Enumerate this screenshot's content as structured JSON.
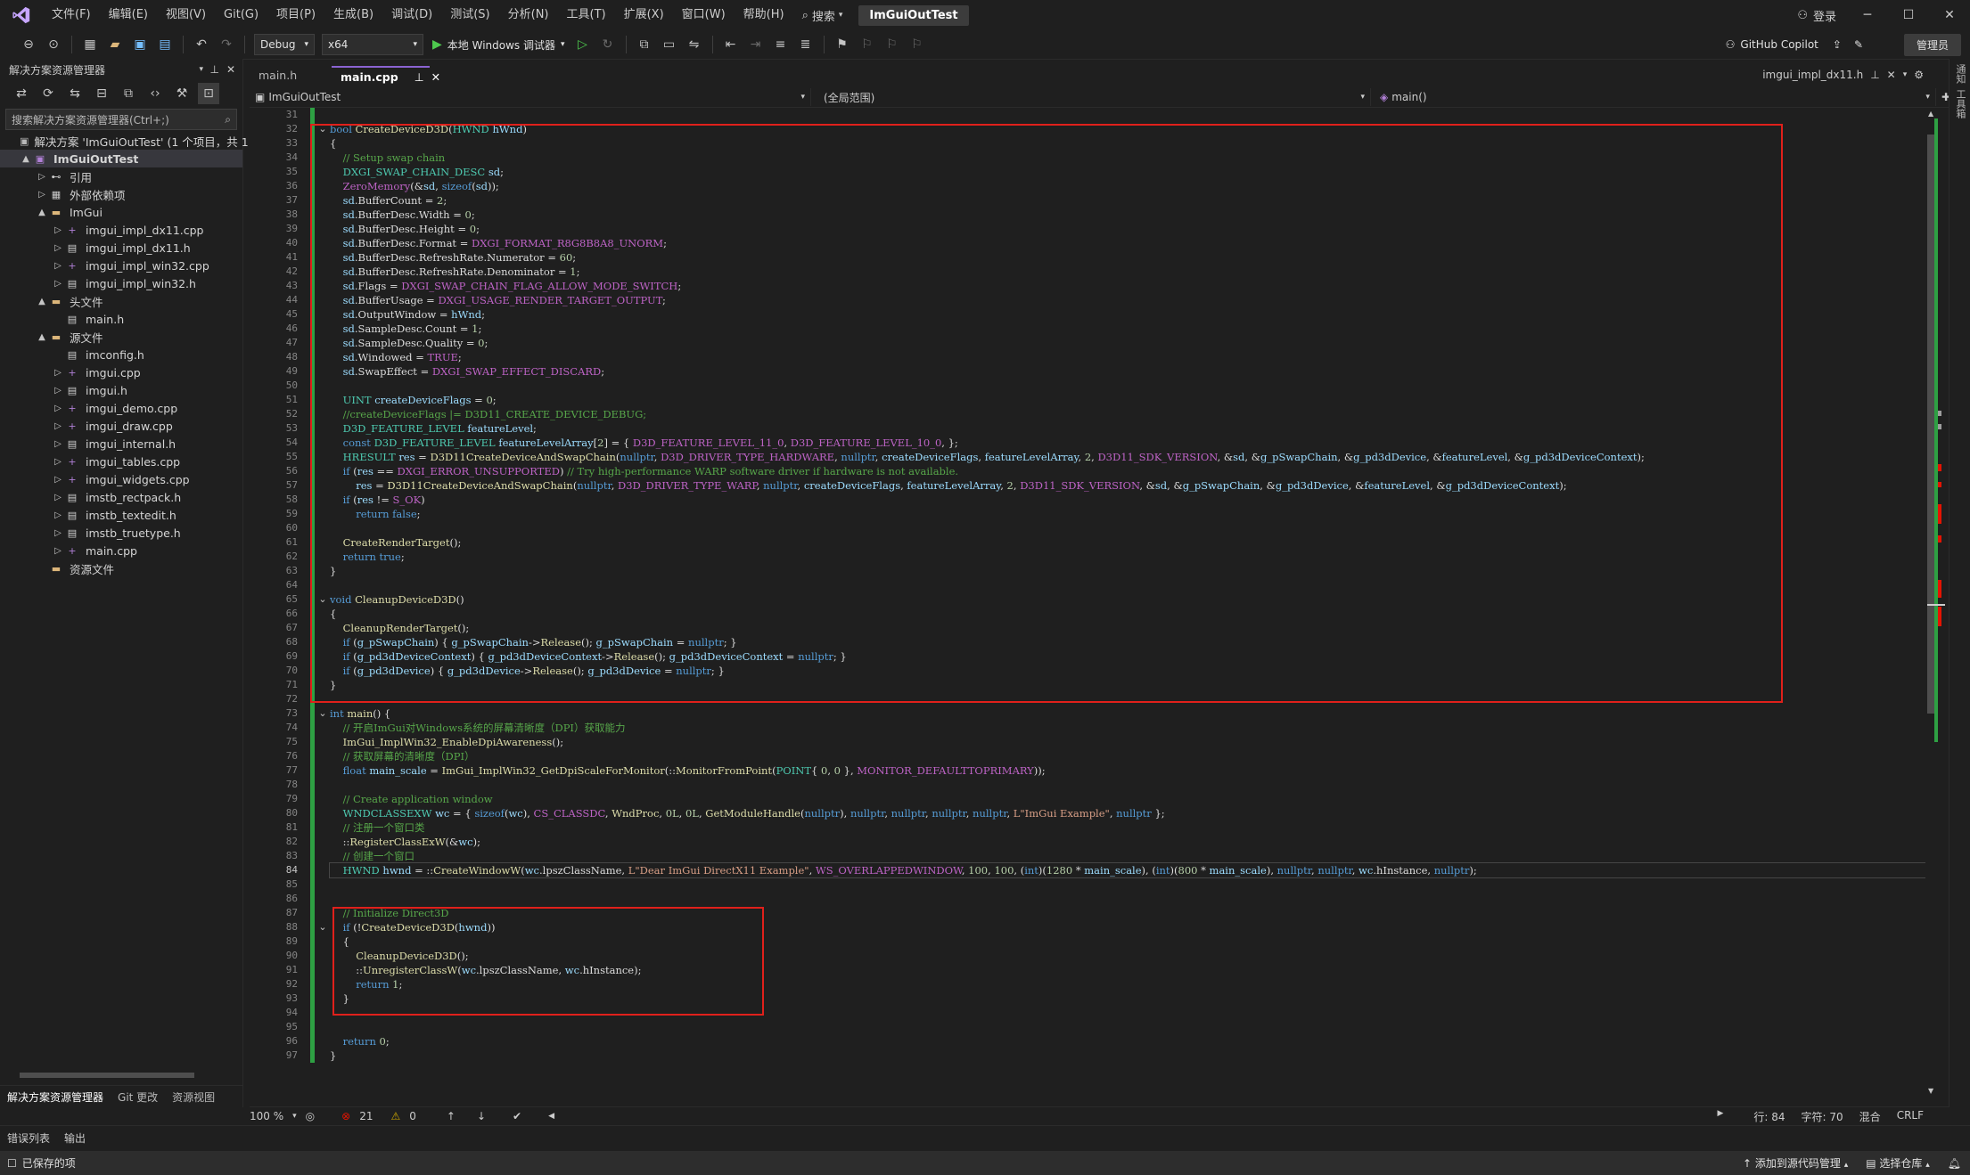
{
  "title_bar": {
    "menu": [
      "文件(F)",
      "编辑(E)",
      "视图(V)",
      "Git(G)",
      "项目(P)",
      "生成(B)",
      "调试(D)",
      "测试(S)",
      "分析(N)",
      "工具(T)",
      "扩展(X)",
      "窗口(W)",
      "帮助(H)"
    ],
    "search_label": "搜索",
    "solution_name": "ImGuiOutTest",
    "login_label": "登录"
  },
  "toolbar": {
    "config": "Debug",
    "platform": "x64",
    "run_label": "本地 Windows 调试器",
    "copilot_label": "GitHub Copilot",
    "admin_label": "管理员"
  },
  "solution_explorer": {
    "title": "解决方案资源管理器",
    "search_placeholder": "搜索解决方案资源管理器(Ctrl+;)",
    "tree": [
      {
        "label": "解决方案 'ImGuiOutTest' (1 个项目，共 1",
        "depth": 0,
        "arrow": "",
        "icon": "solution-icon"
      },
      {
        "label": "ImGuiOutTest",
        "depth": 0,
        "arrow": "▲",
        "icon": "project-icon",
        "bold": true,
        "selected": true
      },
      {
        "label": "引用",
        "depth": 1,
        "arrow": "▷",
        "icon": "references-icon"
      },
      {
        "label": "外部依赖项",
        "depth": 1,
        "arrow": "▷",
        "icon": "external-deps-icon"
      },
      {
        "label": "ImGui",
        "depth": 1,
        "arrow": "▲",
        "icon": "folder-icon"
      },
      {
        "label": "imgui_impl_dx11.cpp",
        "depth": 2,
        "arrow": "▷",
        "icon": "cpp-file-icon"
      },
      {
        "label": "imgui_impl_dx11.h",
        "depth": 2,
        "arrow": "▷",
        "icon": "header-file-icon"
      },
      {
        "label": "imgui_impl_win32.cpp",
        "depth": 2,
        "arrow": "▷",
        "icon": "cpp-file-icon"
      },
      {
        "label": "imgui_impl_win32.h",
        "depth": 2,
        "arrow": "▷",
        "icon": "header-file-icon"
      },
      {
        "label": "头文件",
        "depth": 1,
        "arrow": "▲",
        "icon": "folder-icon"
      },
      {
        "label": "main.h",
        "depth": 2,
        "arrow": "",
        "icon": "header-file-icon"
      },
      {
        "label": "源文件",
        "depth": 1,
        "arrow": "▲",
        "icon": "folder-icon"
      },
      {
        "label": "imconfig.h",
        "depth": 2,
        "arrow": "",
        "icon": "header-file-icon"
      },
      {
        "label": "imgui.cpp",
        "depth": 2,
        "arrow": "▷",
        "icon": "cpp-file-icon"
      },
      {
        "label": "imgui.h",
        "depth": 2,
        "arrow": "▷",
        "icon": "header-file-icon"
      },
      {
        "label": "imgui_demo.cpp",
        "depth": 2,
        "arrow": "▷",
        "icon": "cpp-file-icon"
      },
      {
        "label": "imgui_draw.cpp",
        "depth": 2,
        "arrow": "▷",
        "icon": "cpp-file-icon"
      },
      {
        "label": "imgui_internal.h",
        "depth": 2,
        "arrow": "▷",
        "icon": "header-file-icon"
      },
      {
        "label": "imgui_tables.cpp",
        "depth": 2,
        "arrow": "▷",
        "icon": "cpp-file-icon"
      },
      {
        "label": "imgui_widgets.cpp",
        "depth": 2,
        "arrow": "▷",
        "icon": "cpp-file-icon"
      },
      {
        "label": "imstb_rectpack.h",
        "depth": 2,
        "arrow": "▷",
        "icon": "header-file-icon"
      },
      {
        "label": "imstb_textedit.h",
        "depth": 2,
        "arrow": "▷",
        "icon": "header-file-icon"
      },
      {
        "label": "imstb_truetype.h",
        "depth": 2,
        "arrow": "▷",
        "icon": "header-file-icon"
      },
      {
        "label": "main.cpp",
        "depth": 2,
        "arrow": "▷",
        "icon": "cpp-file-icon"
      },
      {
        "label": "资源文件",
        "depth": 1,
        "arrow": "",
        "icon": "folder-icon"
      }
    ],
    "bottom_tabs": [
      "解决方案资源管理器",
      "Git 更改",
      "资源视图"
    ]
  },
  "editor": {
    "tabs": [
      {
        "label": "main.h",
        "active": false
      },
      {
        "label": "main.cpp",
        "active": true
      }
    ],
    "right_tab": "imgui_impl_dx11.h",
    "nav_project": "ImGuiOutTest",
    "nav_scope": "(全局范围)",
    "nav_member": "main()",
    "current_line": 84,
    "lines": [
      {
        "n": 31,
        "fold": "",
        "html": ""
      },
      {
        "n": 32,
        "fold": "⌄",
        "html": "<span class='kw'>bool</span> <span class='fn'>CreateDeviceD3D</span>(<span class='ty'>HWND</span> <span class='va'>hWnd</span>)"
      },
      {
        "n": 33,
        "fold": "",
        "html": "{"
      },
      {
        "n": 34,
        "fold": "",
        "html": "    <span class='cm'>// Setup swap chain</span>"
      },
      {
        "n": 35,
        "fold": "",
        "html": "    <span class='ty'>DXGI_SWAP_CHAIN_DESC</span> <span class='va'>sd</span>;"
      },
      {
        "n": 36,
        "fold": "",
        "html": "    <span class='mc'>ZeroMemory</span>(&amp;<span class='va'>sd</span>, <span class='kw'>sizeof</span>(<span class='va'>sd</span>));"
      },
      {
        "n": 37,
        "fold": "",
        "html": "    <span class='va'>sd</span>.BufferCount = <span class='nu'>2</span>;"
      },
      {
        "n": 38,
        "fold": "",
        "html": "    <span class='va'>sd</span>.BufferDesc.Width = <span class='nu'>0</span>;"
      },
      {
        "n": 39,
        "fold": "",
        "html": "    <span class='va'>sd</span>.BufferDesc.Height = <span class='nu'>0</span>;"
      },
      {
        "n": 40,
        "fold": "",
        "html": "    <span class='va'>sd</span>.BufferDesc.Format = <span class='mc'>DXGI_FORMAT_R8G8B8A8_UNORM</span>;"
      },
      {
        "n": 41,
        "fold": "",
        "html": "    <span class='va'>sd</span>.BufferDesc.RefreshRate.Numerator = <span class='nu'>60</span>;"
      },
      {
        "n": 42,
        "fold": "",
        "html": "    <span class='va'>sd</span>.BufferDesc.RefreshRate.Denominator = <span class='nu'>1</span>;"
      },
      {
        "n": 43,
        "fold": "",
        "html": "    <span class='va'>sd</span>.Flags = <span class='mc'>DXGI_SWAP_CHAIN_FLAG_ALLOW_MODE_SWITCH</span>;"
      },
      {
        "n": 44,
        "fold": "",
        "html": "    <span class='va'>sd</span>.BufferUsage = <span class='mc'>DXGI_USAGE_RENDER_TARGET_OUTPUT</span>;"
      },
      {
        "n": 45,
        "fold": "",
        "html": "    <span class='va'>sd</span>.OutputWindow = <span class='va'>hWnd</span>;"
      },
      {
        "n": 46,
        "fold": "",
        "html": "    <span class='va'>sd</span>.SampleDesc.Count = <span class='nu'>1</span>;"
      },
      {
        "n": 47,
        "fold": "",
        "html": "    <span class='va'>sd</span>.SampleDesc.Quality = <span class='nu'>0</span>;"
      },
      {
        "n": 48,
        "fold": "",
        "html": "    <span class='va'>sd</span>.Windowed = <span class='mc'>TRUE</span>;"
      },
      {
        "n": 49,
        "fold": "",
        "html": "    <span class='va'>sd</span>.SwapEffect = <span class='mc'>DXGI_SWAP_EFFECT_DISCARD</span>;"
      },
      {
        "n": 50,
        "fold": "",
        "html": ""
      },
      {
        "n": 51,
        "fold": "",
        "html": "    <span class='ty'>UINT</span> <span class='va'>createDeviceFlags</span> = <span class='nu'>0</span>;"
      },
      {
        "n": 52,
        "fold": "",
        "html": "    <span class='cm'>//createDeviceFlags |= D3D11_CREATE_DEVICE_DEBUG;</span>"
      },
      {
        "n": 53,
        "fold": "",
        "html": "    <span class='ty'>D3D_FEATURE_LEVEL</span> <span class='va'>featureLevel</span>;"
      },
      {
        "n": 54,
        "fold": "",
        "html": "    <span class='kw'>const</span> <span class='ty'>D3D_FEATURE_LEVEL</span> <span class='va'>featureLevelArray</span>[<span class='nu'>2</span>] = { <span class='mc'>D3D_FEATURE_LEVEL_11_0</span>, <span class='mc'>D3D_FEATURE_LEVEL_10_0</span>, };"
      },
      {
        "n": 55,
        "fold": "",
        "html": "    <span class='ty'>HRESULT</span> <span class='va'>res</span> = <span class='fn'>D3D11CreateDeviceAndSwapChain</span>(<span class='kw'>nullptr</span>, <span class='mc'>D3D_DRIVER_TYPE_HARDWARE</span>, <span class='kw'>nullptr</span>, <span class='va'>createDeviceFlags</span>, <span class='va'>featureLevelArray</span>, <span class='nu'>2</span>, <span class='mc'>D3D11_SDK_VERSION</span>, &amp;<span class='va'>sd</span>, &amp;<span class='va'>g_pSwapChain</span>, &amp;<span class='va'>g_pd3dDevice</span>, &amp;<span class='va'>featureLevel</span>, &amp;<span class='va'>g_pd3dDeviceContext</span>);"
      },
      {
        "n": 56,
        "fold": "",
        "html": "    <span class='kw'>if</span> (<span class='va'>res</span> == <span class='mc'>DXGI_ERROR_UNSUPPORTED</span>) <span class='cm'>// Try high-performance WARP software driver if hardware is not available.</span>"
      },
      {
        "n": 57,
        "fold": "",
        "html": "        <span class='va'>res</span> = <span class='fn'>D3D11CreateDeviceAndSwapChain</span>(<span class='kw'>nullptr</span>, <span class='mc'>D3D_DRIVER_TYPE_WARP</span>, <span class='kw'>nullptr</span>, <span class='va'>createDeviceFlags</span>, <span class='va'>featureLevelArray</span>, <span class='nu'>2</span>, <span class='mc'>D3D11_SDK_VERSION</span>, &amp;<span class='va'>sd</span>, &amp;<span class='va'>g_pSwapChain</span>, &amp;<span class='va'>g_pd3dDevice</span>, &amp;<span class='va'>featureLevel</span>, &amp;<span class='va'>g_pd3dDeviceContext</span>);"
      },
      {
        "n": 58,
        "fold": "",
        "html": "    <span class='kw'>if</span> (<span class='va'>res</span> != <span class='mc'>S_OK</span>)"
      },
      {
        "n": 59,
        "fold": "",
        "html": "        <span class='kw'>return</span> <span class='kw'>false</span>;"
      },
      {
        "n": 60,
        "fold": "",
        "html": ""
      },
      {
        "n": 61,
        "fold": "",
        "html": "    <span class='fn'>CreateRenderTarget</span>();"
      },
      {
        "n": 62,
        "fold": "",
        "html": "    <span class='kw'>return</span> <span class='kw'>true</span>;"
      },
      {
        "n": 63,
        "fold": "",
        "html": "}"
      },
      {
        "n": 64,
        "fold": "",
        "html": ""
      },
      {
        "n": 65,
        "fold": "⌄",
        "html": "<span class='kw'>void</span> <span class='fn'>CleanupDeviceD3D</span>()"
      },
      {
        "n": 66,
        "fold": "",
        "html": "{"
      },
      {
        "n": 67,
        "fold": "",
        "html": "    <span class='fn'>CleanupRenderTarget</span>();"
      },
      {
        "n": 68,
        "fold": "",
        "html": "    <span class='kw'>if</span> (<span class='va'>g_pSwapChain</span>) { <span class='va'>g_pSwapChain</span>-&gt;<span class='fn'>Release</span>(); <span class='va'>g_pSwapChain</span> = <span class='kw'>nullptr</span>; }"
      },
      {
        "n": 69,
        "fold": "",
        "html": "    <span class='kw'>if</span> (<span class='va'>g_pd3dDeviceContext</span>) { <span class='va'>g_pd3dDeviceContext</span>-&gt;<span class='fn'>Release</span>(); <span class='va'>g_pd3dDeviceContext</span> = <span class='kw'>nullptr</span>; }"
      },
      {
        "n": 70,
        "fold": "",
        "html": "    <span class='kw'>if</span> (<span class='va'>g_pd3dDevice</span>) { <span class='va'>g_pd3dDevice</span>-&gt;<span class='fn'>Release</span>(); <span class='va'>g_pd3dDevice</span> = <span class='kw'>nullptr</span>; }"
      },
      {
        "n": 71,
        "fold": "",
        "html": "}"
      },
      {
        "n": 72,
        "fold": "",
        "html": ""
      },
      {
        "n": 73,
        "fold": "⌄",
        "html": "<span class='kw'>int</span> <span class='fn'>main</span>() {"
      },
      {
        "n": 74,
        "fold": "",
        "html": "    <span class='cm'>// 开启ImGui对Windows系统的屏幕清晰度（DPI）获取能力</span>"
      },
      {
        "n": 75,
        "fold": "",
        "html": "    <span class='fn'>ImGui_ImplWin32_EnableDpiAwareness</span>();"
      },
      {
        "n": 76,
        "fold": "",
        "html": "    <span class='cm'>// 获取屏幕的清晰度（DPI）</span>"
      },
      {
        "n": 77,
        "fold": "",
        "html": "    <span class='kw'>float</span> <span class='va'>main_scale</span> = <span class='fn'>ImGui_ImplWin32_GetDpiScaleForMonitor</span>(::<span class='fn'>MonitorFromPoint</span>(<span class='ty'>POINT</span>{ <span class='nu'>0</span>, <span class='nu'>0</span> }, <span class='mc'>MONITOR_DEFAULTTOPRIMARY</span>));"
      },
      {
        "n": 78,
        "fold": "",
        "html": ""
      },
      {
        "n": 79,
        "fold": "",
        "html": "    <span class='cm'>// Create application window</span>"
      },
      {
        "n": 80,
        "fold": "",
        "html": "    <span class='ty'>WNDCLASSEXW</span> <span class='va'>wc</span> = { <span class='kw'>sizeof</span>(<span class='va'>wc</span>), <span class='mc'>CS_CLASSDC</span>, <span class='fn'>WndProc</span>, <span class='nu'>0L</span>, <span class='nu'>0L</span>, <span class='fn'>GetModuleHandle</span>(<span class='kw'>nullptr</span>), <span class='kw'>nullptr</span>, <span class='kw'>nullptr</span>, <span class='kw'>nullptr</span>, <span class='kw'>nullptr</span>, <span class='st'>L\"ImGui Example\"</span>, <span class='kw'>nullptr</span> };"
      },
      {
        "n": 81,
        "fold": "",
        "html": "    <span class='cm'>// 注册一个窗口类</span>"
      },
      {
        "n": 82,
        "fold": "",
        "html": "    ::<span class='fn'>RegisterClassExW</span>(&amp;<span class='va'>wc</span>);"
      },
      {
        "n": 83,
        "fold": "",
        "html": "    <span class='cm'>// 创建一个窗口</span>"
      },
      {
        "n": 84,
        "fold": "",
        "html": "    <span class='ty'>HWND</span> <span class='va'>hwnd</span> = ::<span class='fn'>CreateWindowW</span>(<span class='va'>wc</span>.lpszClassName, <span class='st'>L\"Dear ImGui DirectX11 Example\"</span>, <span class='mc'>WS_OVERLAPPEDWINDOW</span>, <span class='nu'>100</span>, <span class='nu'>100</span>, (<span class='kw'>int</span>)(<span class='nu'>1280</span> * <span class='va'>main_scale</span>), (<span class='kw'>int</span>)(<span class='nu'>800</span> * <span class='va'>main_scale</span>), <span class='kw'>nullptr</span>, <span class='kw'>nullptr</span>, <span class='va'>wc</span>.hInstance, <span class='kw'>nullptr</span>);"
      },
      {
        "n": 85,
        "fold": "",
        "html": ""
      },
      {
        "n": 86,
        "fold": "",
        "html": ""
      },
      {
        "n": 87,
        "fold": "",
        "html": "    <span class='cm'>// Initialize Direct3D</span>"
      },
      {
        "n": 88,
        "fold": "⌄",
        "html": "    <span class='kw'>if</span> (!<span class='fn'>CreateDeviceD3D</span>(<span class='va'>hwnd</span>))"
      },
      {
        "n": 89,
        "fold": "",
        "html": "    {"
      },
      {
        "n": 90,
        "fold": "",
        "html": "        <span class='fn'>CleanupDeviceD3D</span>();"
      },
      {
        "n": 91,
        "fold": "",
        "html": "        ::<span class='fn'>UnregisterClassW</span>(<span class='va'>wc</span>.lpszClassName, <span class='va'>wc</span>.hInstance);"
      },
      {
        "n": 92,
        "fold": "",
        "html": "        <span class='kw'>return</span> <span class='nu'>1</span>;"
      },
      {
        "n": 93,
        "fold": "",
        "html": "    }"
      },
      {
        "n": 94,
        "fold": "",
        "html": ""
      },
      {
        "n": 95,
        "fold": "",
        "html": ""
      },
      {
        "n": 96,
        "fold": "",
        "html": "    <span class='kw'>return</span> <span class='nu'>0</span>;"
      },
      {
        "n": 97,
        "fold": "",
        "html": "}"
      }
    ]
  },
  "editor_status": {
    "zoom": "100 %",
    "errors": "21",
    "warnings": "0",
    "line": "行: 84",
    "char": "字符: 70",
    "mix": "混合",
    "eol": "CRLF"
  },
  "output_tabs": [
    "错误列表",
    "输出"
  ],
  "status_bar": {
    "saved": "已保存的项",
    "source_control": "添加到源代码管理",
    "repo": "选择仓库"
  },
  "right_strip": [
    "通知",
    "工具箱"
  ],
  "colors": {
    "accent": "#8a63d2",
    "annotation": "#e0201b",
    "change_bar": "#2ea043",
    "error": "#e51400"
  }
}
